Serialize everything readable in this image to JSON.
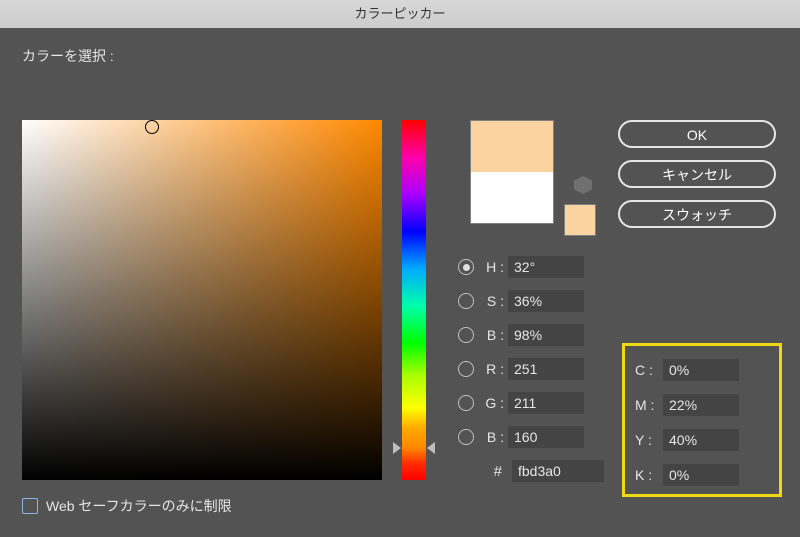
{
  "title": "カラーピッカー",
  "select_label": "カラーを選択 :",
  "buttons": {
    "ok": "OK",
    "cancel": "キャンセル",
    "swatch": "スウォッチ"
  },
  "hsb": {
    "h_label": "H :",
    "h_value": "32°",
    "s_label": "S :",
    "s_value": "36%",
    "b_label": "B :",
    "b_value": "98%"
  },
  "rgb": {
    "r_label": "R :",
    "r_value": "251",
    "g_label": "G :",
    "g_value": "211",
    "b_label": "B :",
    "b_value": "160"
  },
  "hex": {
    "label": "#",
    "value": "fbd3a0"
  },
  "cmyk": {
    "c_label": "C :",
    "c_value": "0%",
    "m_label": "M :",
    "m_value": "22%",
    "y_label": "Y :",
    "y_value": "40%",
    "k_label": "K :",
    "k_value": "0%"
  },
  "websafe_label": "Web セーフカラーのみに制限",
  "colors": {
    "selected": "#fbd3a0",
    "previous": "#ffffff",
    "highlight_box": "#f0d815"
  },
  "sv_cursor": {
    "x_pct": 36,
    "y_pct": 2
  },
  "hue_pos_pct": 91
}
